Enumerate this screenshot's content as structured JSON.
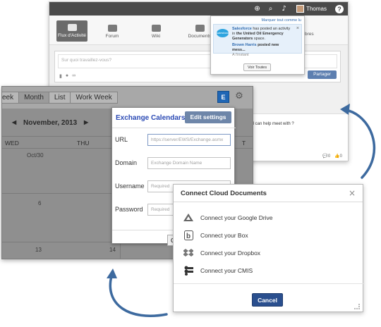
{
  "intranet": {
    "topbar": {
      "user_name": "Thomas",
      "help": "?"
    },
    "nav": [
      {
        "label": "Flux d'Activité",
        "active": true
      },
      {
        "label": "Forum"
      },
      {
        "label": "Wiki"
      },
      {
        "label": "Documents"
      },
      {
        "label": "C"
      }
    ],
    "nav_partial_label": "bres",
    "composer": {
      "placeholder": "Sur quoi travaillez-vous?",
      "share_label": "Partager"
    },
    "notification": {
      "mark_all": "Marquer tout comme lu",
      "sender": "Salesforce",
      "text_before": " has posted an activity in ",
      "space": "the United Oil Emergency Generators",
      "text_after": " space.",
      "poster": "Brown Harris",
      "poster_text": " posted new mess...",
      "time": "A l'instant",
      "see_all": "Voir Toutes",
      "logo_text": "salesforce"
    },
    "feed": {
      "text": "rospect I can help meet with ?",
      "comments": "0",
      "likes": "0"
    }
  },
  "calendar": {
    "view_tabs": [
      "eek",
      "Month",
      "List",
      "Work Week"
    ],
    "active_tab": "Month",
    "exchange_icon": "E",
    "month_label": "November, 2013",
    "day_headers": [
      "WED",
      "THU",
      "T"
    ],
    "dates": [
      "Oct/30",
      "6",
      "13",
      "14"
    ],
    "exchange_dialog": {
      "title": "Exchange Calendars",
      "edit_label": "Edit settings",
      "fields": [
        {
          "label": "URL",
          "placeholder": "https://server/EWS/Exchange.asmx"
        },
        {
          "label": "Domain",
          "placeholder": "Exchange Domain Name"
        },
        {
          "label": "Username",
          "placeholder": "Required"
        },
        {
          "label": "Password",
          "placeholder": "Required"
        }
      ],
      "cancel_partial": "C"
    }
  },
  "cloud": {
    "title": "Connect Cloud Documents",
    "close": "×",
    "items": [
      {
        "label": "Connect your Google Drive",
        "icon": "google-drive-icon"
      },
      {
        "label": "Connect your Box",
        "icon": "box-icon"
      },
      {
        "label": "Connect your Dropbox",
        "icon": "dropbox-icon"
      },
      {
        "label": "Connect your CMIS",
        "icon": "cmis-icon"
      }
    ],
    "cancel_label": "Cancel"
  },
  "colors": {
    "arrow": "#3d6a9f",
    "accent_blue": "#2a4f8e",
    "exchange_blue": "#1f66b5",
    "share_blue": "#5d7fb0"
  }
}
